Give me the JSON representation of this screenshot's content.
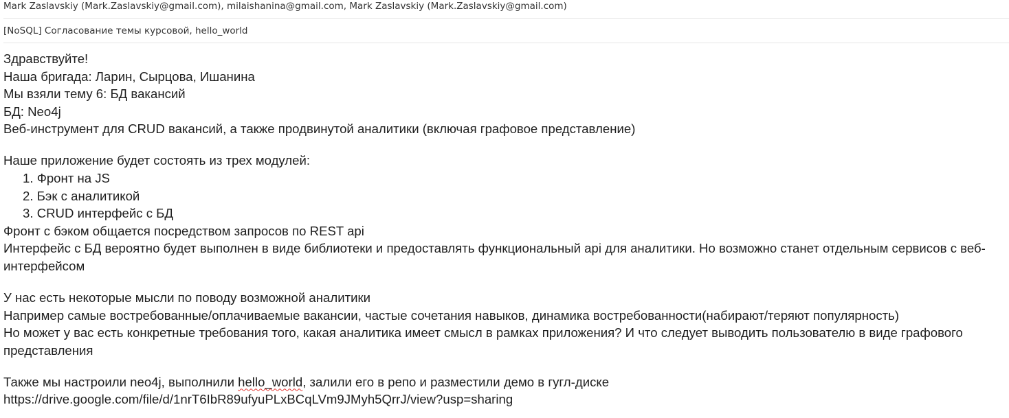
{
  "email": {
    "recipients": "Mark Zaslavskiy (Mark.Zaslavskiy@gmail.com), milaishanina@gmail.com, Mark Zaslavskiy (Mark.Zaslavskiy@gmail.com)",
    "subject": "[NoSQL] Согласование темы курсовой, hello_world",
    "body": {
      "p1": [
        "Здравствуйте!",
        "Наша бригада: Ларин, Сырцова, Ишанина",
        "Мы взяли тему 6: БД вакансий",
        "БД: Neo4j",
        "Веб-инструмент для CRUD вакансий, а также продвинутой аналитики (включая графовое представление)"
      ],
      "p2_intro": "Наше приложение будет состоять из трех модулей:",
      "modules": [
        {
          "num": "1.",
          "text": "Фронт на JS"
        },
        {
          "num": "2.",
          "text": "Бэк с аналитикой"
        },
        {
          "num": "3.",
          "text": "CRUD интерфейс с БД"
        }
      ],
      "p2_after": [
        "Фронт с бэком общается посредством запросов по REST api",
        "Интерфейс с БД вероятно будет выполнен в виде библиотеки и предоставлять функциональный api для аналитики. Но возможно станет отдельным сервисов с веб-",
        "интерфейсом"
      ],
      "p3": [
        "У нас есть некоторые мысли по поводу возможной аналитики",
        "Например самые востребованные/оплачиваемые вакансии, частые сочетания навыков, динамика востребованности(набирают/теряют популярность)",
        "Но может у вас есть конкретные требования того, какая аналитика имеет смысл в рамках приложения? И что следует выводить пользователю в виде графового",
        "представления"
      ],
      "p4": {
        "before": "Также мы настроили neo4j, выполнили ",
        "misspelled": "hello_world",
        "after": ", залили его в репо и разместили демо в гугл-диске",
        "link": "https://drive.google.com/file/d/1nrT6IbR89ufyuPLxBCqLVm9JMyh5QrrJ/view?usp=sharing"
      }
    }
  },
  "colors": {
    "text": "#1f1f1f",
    "header_text": "#333333",
    "divider": "#e4e4e4",
    "spellcheck": "#e53935"
  }
}
